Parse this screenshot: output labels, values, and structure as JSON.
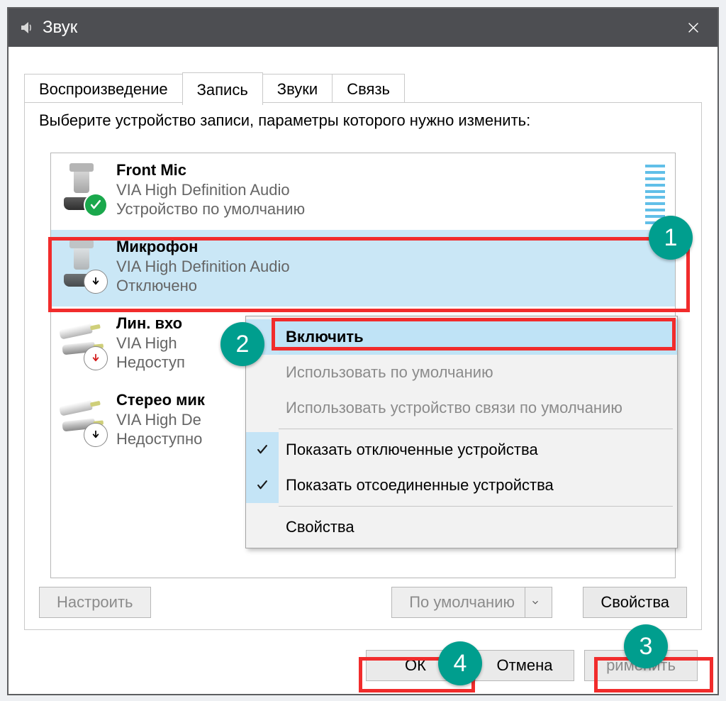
{
  "window": {
    "title": "Звук"
  },
  "tabs": {
    "playback": "Воспроизведение",
    "recording": "Запись",
    "sounds": "Звуки",
    "communications": "Связь",
    "active": "recording"
  },
  "instruction": "Выберите устройство записи, параметры которого нужно изменить:",
  "devices": {
    "items": [
      {
        "name": "Front Mic",
        "driver": "VIA High Definition Audio",
        "status": "Устройство по умолчанию",
        "state": "default"
      },
      {
        "name": "Микрофон",
        "driver": "VIA High Definition Audio",
        "status": "Отключено",
        "state": "disabled",
        "selected": true
      },
      {
        "name": "Лин. вхо",
        "driver": "VIA High",
        "status": "Недоступ",
        "state": "unavailable"
      },
      {
        "name": "Стерео мик",
        "driver": "VIA High De",
        "status": "Недоступно",
        "state": "unavailable2"
      }
    ]
  },
  "context_menu": {
    "enable": "Включить",
    "set_default": "Использовать по умолчанию",
    "set_default_comm": "Использовать устройство связи по умолчанию",
    "show_disabled": "Показать отключенные устройства",
    "show_disconnected": "Показать отсоединенные устройства",
    "properties": "Свойства",
    "show_disabled_checked": true,
    "show_disconnected_checked": true
  },
  "buttons": {
    "configure": "Настроить",
    "default_dropdown": "По умолчанию",
    "properties": "Свойства",
    "ok": "ОК",
    "cancel": "Отмена",
    "apply": "рименить"
  },
  "annotations": {
    "steps": {
      "1": "1",
      "2": "2",
      "3": "3",
      "4": "4"
    }
  }
}
